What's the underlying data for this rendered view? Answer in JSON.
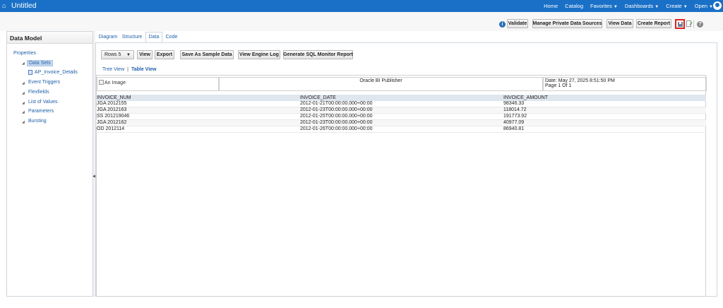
{
  "topbar": {
    "title": "Untitled",
    "nav": {
      "home": "Home",
      "catalog": "Catalog",
      "favorites": "Favorites",
      "dashboards": "Dashboards",
      "create": "Create",
      "open": "Open"
    }
  },
  "toolbar": {
    "validate": "Validate",
    "manage_sources": "Manage Private Data Sources",
    "view_data": "View Data",
    "create_report": "Create Report"
  },
  "left_panel": {
    "title": "Data Model",
    "tree": {
      "properties": "Properties",
      "data_sets": "Data Sets",
      "dataset_item": "AP_Invoice_Details",
      "event_triggers": "Event Triggers",
      "flexfields": "Flexfields",
      "list_of_values": "List of Values",
      "parameters": "Parameters",
      "bursting": "Bursting"
    }
  },
  "tabs": [
    "Diagram",
    "Structure",
    "Data",
    "Code"
  ],
  "data_toolbar": {
    "rows_label": "Rows",
    "rows_value": "5",
    "view": "View",
    "export": "Export",
    "save_sample": "Save As Sample Data",
    "view_engine_log": "View Engine Log",
    "sql_monitor": "Generate SQL Monitor Report"
  },
  "view_links": {
    "tree_view": "Tree View",
    "separator": "|",
    "table_view": "Table View"
  },
  "report_header": {
    "image_alt": "An Image",
    "publisher": "Oracle BI Publisher",
    "date": "Date: May 27, 2025 8:51:50 PM",
    "page": "Page 1 Of 1"
  },
  "table": {
    "columns": [
      "INVOICE_NUM",
      "INVOICE_DATE",
      "INVOICE_AMOUNT"
    ],
    "rows": [
      [
        "JGA 2012155",
        "2012-01-21T00:00:00.000+00:00",
        "98346.33"
      ],
      [
        "JGA 2012163",
        "2012-01-23T00:00:00.000+00:00",
        "118014.72"
      ],
      [
        "SS 201219046",
        "2012-01-25T00:00:00.000+00:00",
        "191773.92"
      ],
      [
        "JGA 2012162",
        "2012-01-23T00:00:00.000+00:00",
        "40977.09"
      ],
      [
        "OD 2012114",
        "2012-01-26T00:00:00.000+00:00",
        "86940.81"
      ]
    ]
  },
  "colors": {
    "topbar": "#1a70c7",
    "link": "#1f5fa8",
    "highlight_border": "#e02020"
  }
}
